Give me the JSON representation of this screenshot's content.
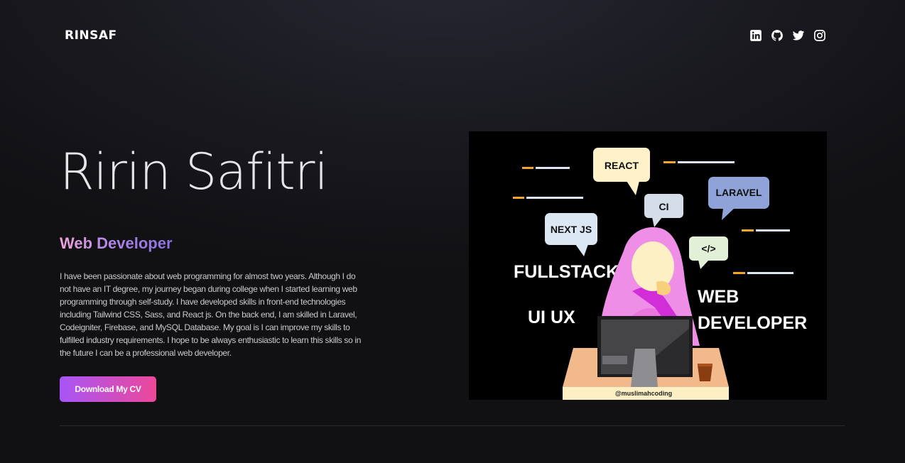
{
  "header": {
    "logo": "RINSAF",
    "social_links": [
      {
        "name": "linkedin-icon",
        "label": "LinkedIn"
      },
      {
        "name": "github-icon",
        "label": "GitHub"
      },
      {
        "name": "twitter-icon",
        "label": "Twitter"
      },
      {
        "name": "instagram-icon",
        "label": "Instagram"
      }
    ]
  },
  "hero": {
    "name": "Ririn Safitri",
    "role": "Web Developer",
    "bio": "I have been passionate about web programming for almost two years. Although I do not have an IT degree, my journey began during college when I started learning web programming through self-study. I have developed skills in front-end technologies including Tailwind CSS, Sass, and React js. On the back end, I am skilled in Laravel, Codeigniter, Firebase, and MySQL Database. My goal is I can improve my skills to fulfilled industry requirements. I hope to be always enthusiastic to learn this skills so in the future I can be a professional web developer.",
    "cv_button": "Download My CV"
  },
  "illustration": {
    "bubbles": {
      "react": "REACT",
      "ci": "CI",
      "laravel": "LARAVEL",
      "nextjs": "NEXT JS",
      "code": "</>"
    },
    "labels": {
      "fullstack": "FULLSTACK",
      "uiux": "UI UX",
      "web": "WEB",
      "developer": "DEVELOPER"
    },
    "credit": "@muslimahcoding"
  },
  "colors": {
    "accent_start": "#a855f7",
    "accent_end": "#ec4899",
    "background": "#16161b"
  }
}
